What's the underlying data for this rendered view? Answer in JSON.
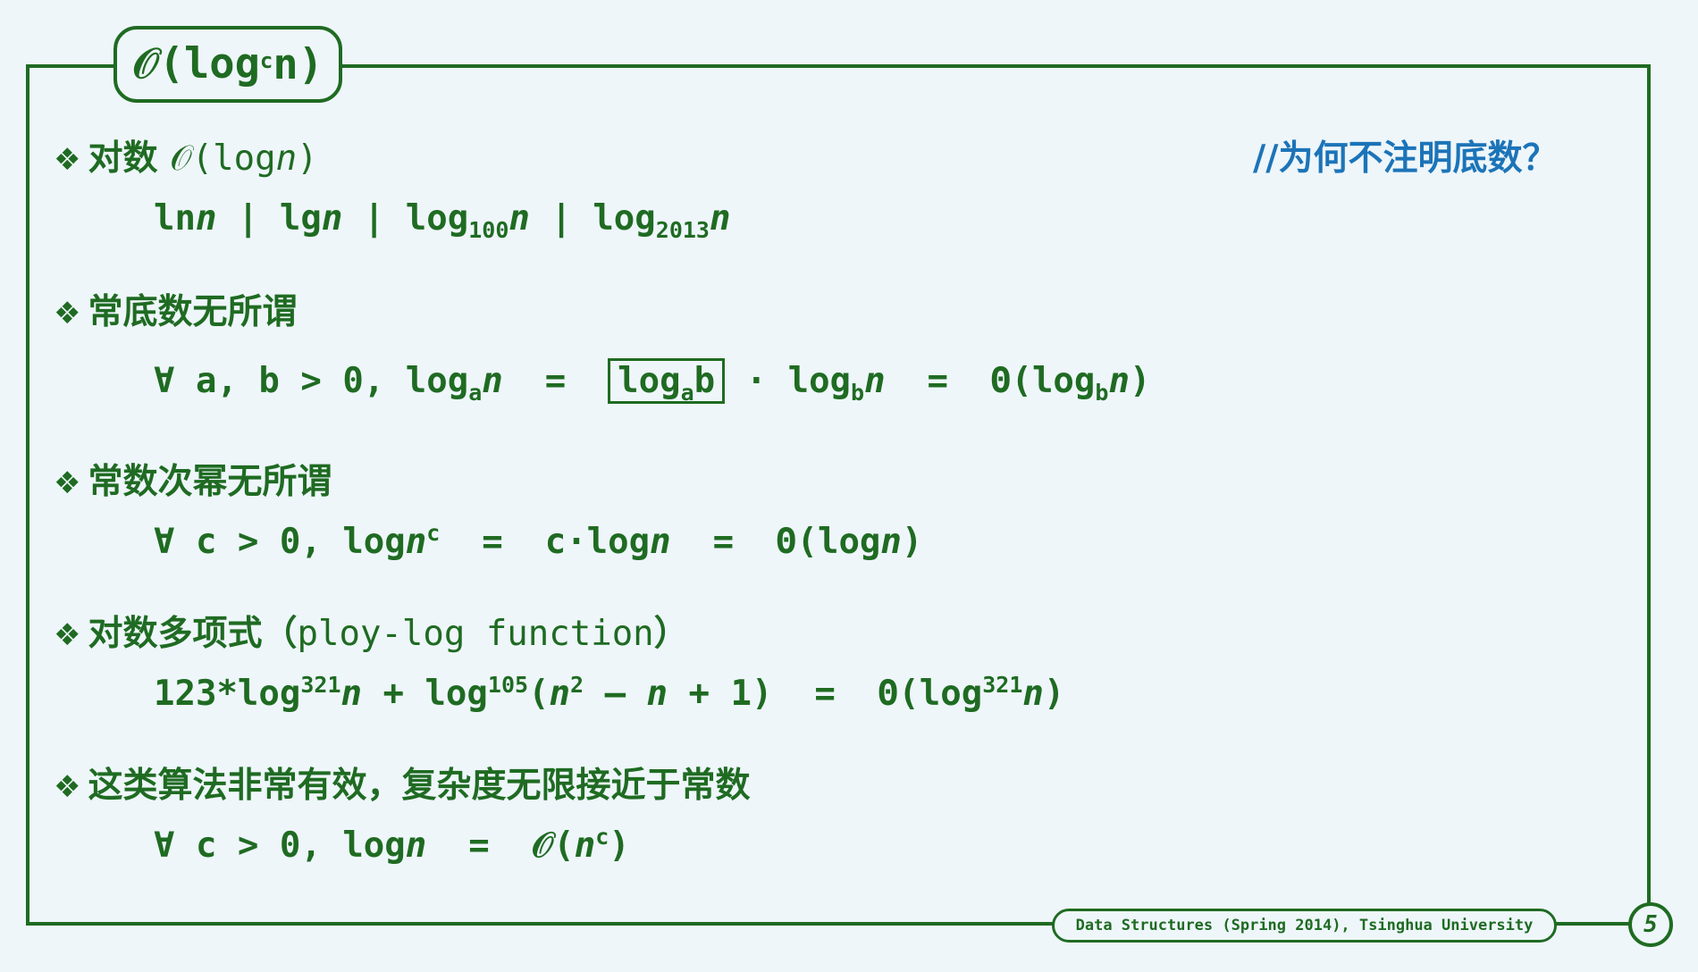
{
  "title": {
    "prefix": "𝒪(log",
    "sup": "c",
    "suffix": "n)"
  },
  "note": "//为何不注明底数？",
  "sections": [
    {
      "label": "对数",
      "math": "𝒪(log",
      "math_var": "n",
      "math_end": ")"
    },
    {
      "label": "常底数无所谓"
    },
    {
      "label": "常数次幂无所谓"
    },
    {
      "label": "对数多项式（",
      "extra": "ploy-log function",
      "close": "）"
    },
    {
      "label": "这类算法非常有效，复杂度无限接近于常数"
    }
  ],
  "bullet": "❖",
  "formulas": {
    "f1": [
      "ln",
      "n",
      " | lg",
      "n",
      " | log",
      "100",
      "n",
      " | log",
      "2013",
      "n"
    ],
    "f2": [
      "∀ a, b > 0, log",
      "a",
      "n",
      "  =  ",
      "log",
      "a",
      "b",
      " · log",
      "b",
      "n",
      "  =  Θ(log",
      "b",
      "n",
      ")"
    ],
    "f3": [
      "∀ c > 0, log",
      "n",
      "c",
      "  =  c·log",
      "n",
      "  =  Θ(log",
      "n",
      ")"
    ],
    "f4": [
      "123*log",
      "321",
      "n",
      " + log",
      "105",
      "(",
      "n",
      "2",
      " – ",
      "n",
      " + 1)  =  Θ(log",
      "321",
      "n",
      ")"
    ],
    "f5": [
      "∀ c > 0, log",
      "n",
      "  =  𝒪(",
      "n",
      "c",
      ")"
    ]
  },
  "footer": "Data Structures (Spring 2014), Tsinghua University",
  "page_number": "5"
}
